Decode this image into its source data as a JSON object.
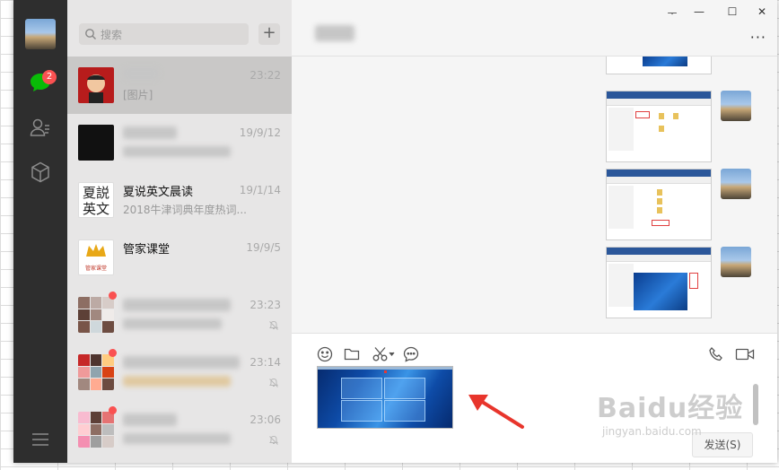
{
  "search": {
    "placeholder": "搜索",
    "add_label": "+"
  },
  "nav": {
    "badge_count": "2"
  },
  "chats": [
    {
      "name": "",
      "preview": "[图片]",
      "time": "23:22",
      "selected": true
    },
    {
      "name": "",
      "preview": "",
      "time": "19/9/12"
    },
    {
      "name": "夏说英文晨读",
      "preview": "2018牛津词典年度热词...",
      "time": "19/1/14"
    },
    {
      "name": "管家课堂",
      "preview": "",
      "time": "19/9/5"
    },
    {
      "name": "",
      "preview": "",
      "time": "23:23",
      "muted": true,
      "unread_dot": true
    },
    {
      "name": "",
      "preview": "",
      "time": "23:14",
      "muted": true,
      "unread_dot": true
    },
    {
      "name": "",
      "preview": "",
      "time": "23:06",
      "muted": true,
      "unread_dot": true
    }
  ],
  "avatar_text": {
    "xiashuo": "夏説英文",
    "guanjia_brand": "管家课堂"
  },
  "window_controls": {
    "pin": "ᅮ",
    "minimize": "—",
    "maximize": "☐",
    "close": "✕"
  },
  "header": {
    "more": "···"
  },
  "input": {
    "send_label": "发送(S)"
  },
  "watermark": {
    "logo": "Baidu经验",
    "url": "jingyan.baidu.com"
  },
  "colors": {
    "nav_bg": "#2e2e2e",
    "badge": "#fa5151",
    "list_bg": "#e7e6e6",
    "selected": "#c9c8c7",
    "arrow": "#e8352c"
  }
}
